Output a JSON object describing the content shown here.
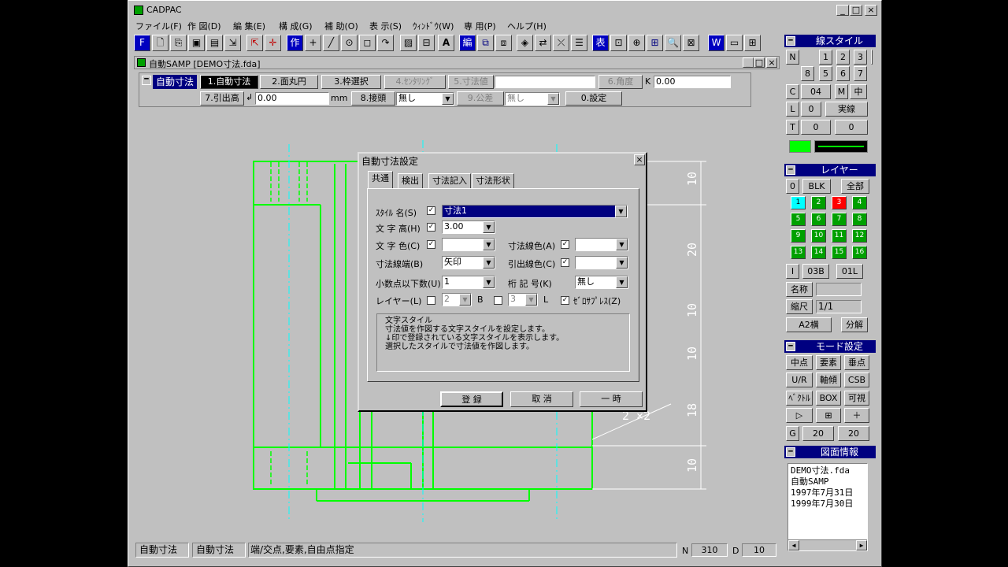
{
  "app": {
    "title": "CADPAC",
    "menu": [
      "ファイル(F)",
      "作 図(D)",
      "編 集(E)",
      "構 成(G)",
      "補 助(O)",
      "表 示(S)",
      "ｳｨﾝﾄﾞｳ(W)",
      "専 用(P)",
      "ヘルプ(H)"
    ],
    "toolbar_letters": {
      "f": "F",
      "make": "作",
      "text": "A",
      "edit": "編",
      "table": "表",
      "w": "W"
    }
  },
  "document": {
    "title": "自動SAMP [DEMO寸法.fda]"
  },
  "dim_bar": {
    "mode": "自動寸法",
    "row1": [
      "1.自動寸法",
      "2.面丸円",
      "3.枠選択",
      "4.ｾﾝﾀﾘﾝｸﾞ",
      "5.寸法値",
      "6.角度"
    ],
    "k_label": "K",
    "k_value": "0.00",
    "row2_leader": "7.引出高",
    "leader_value": "0.00",
    "mm": "mm",
    "contact_label": "8.接頭",
    "contact_value": "無し",
    "tol_label": "9.公差",
    "tol_value": "無し",
    "settings": "0.設定"
  },
  "dialog": {
    "title": "自動寸法設定",
    "tabs": [
      "共通",
      "検出",
      "寸法記入",
      "寸法形状"
    ],
    "style_name_label": "ｽﾀｲﾙ 名(S)",
    "style_name_value": "寸法1",
    "text_height_label": "文 字 高(H)",
    "text_height_value": "3.00",
    "text_color_label": "文 字 色(C)",
    "dim_line_color_label": "寸法線色(A)",
    "dim_end_label": "寸法線端(B)",
    "dim_end_value": "矢印",
    "leader_color_label": "引出線色(C)",
    "decimals_label": "小数点以下数(U)",
    "decimals_value": "1",
    "digit_sym_label": "桁 記 号(K)",
    "digit_sym_value": "無し",
    "layer_label": "レイヤー(L)",
    "layer_b_value": "2",
    "b": "B",
    "layer_l_value": "3",
    "l": "L",
    "zero_suppress": "ｾﾞﾛｻﾌﾟﾚｽ(Z)",
    "desc": [
      "文字スタイル",
      "寸法値を作図する文字スタイルを設定します。",
      "↓印で登録されている文字スタイルを表示します。",
      "選択したスタイルで寸法値を作図します。"
    ],
    "buttons": [
      "登 録",
      "取 消",
      "一 時"
    ]
  },
  "drawing": {
    "dims": [
      "10",
      "20",
      "10",
      "10",
      "18",
      "10"
    ],
    "chamfer": "2 ×2"
  },
  "line_style": {
    "title": "線スタイル",
    "r1": [
      "N",
      "1",
      "2",
      "3",
      "4"
    ],
    "r2": [
      "5",
      "6",
      "7",
      "8"
    ],
    "c_label": "C",
    "c_value": "04",
    "m": "M",
    "m_value": "中",
    "l_label": "L",
    "l_value": "0",
    "l_name": "実線",
    "t_label": "T",
    "t_v1": "0",
    "t_v2": "0",
    "color": "#00ff00"
  },
  "layer": {
    "title": "レイヤー",
    "zero": "0",
    "blk": "BLK",
    "all": "全部",
    "cells": [
      "1",
      "2",
      "3",
      "4",
      "5",
      "6",
      "7",
      "8",
      "9",
      "10",
      "11",
      "12",
      "13",
      "14",
      "15",
      "16"
    ],
    "i_label": "I",
    "i_v1": "03B",
    "i_v2": "01L",
    "name": "名称",
    "scale": "縮尺",
    "scale_value": "1/1",
    "paper": "A2横",
    "split": "分解"
  },
  "mode": {
    "title": "モード設定",
    "r1": [
      "中点",
      "要素",
      "垂点"
    ],
    "r2": [
      "U/R",
      "軸傾",
      "CSB"
    ],
    "r3": [
      "ﾍﾞｸﾄﾙ",
      "BOX",
      "可視"
    ],
    "r4": [
      "▷",
      "⊞",
      "＋"
    ],
    "g": "G",
    "g1": "20",
    "g2": "20"
  },
  "info": {
    "title": "図面情報",
    "lines": [
      "DEMO寸法.fda",
      "自動SAMP",
      "1997年7月31日",
      "1999年7月30日"
    ]
  },
  "status": {
    "s1": "自動寸法",
    "s2": "自動寸法",
    "s3": "端/交点,要素,自由点指定",
    "n": "N",
    "n_value": "310",
    "d": "D",
    "d_value": "10"
  }
}
